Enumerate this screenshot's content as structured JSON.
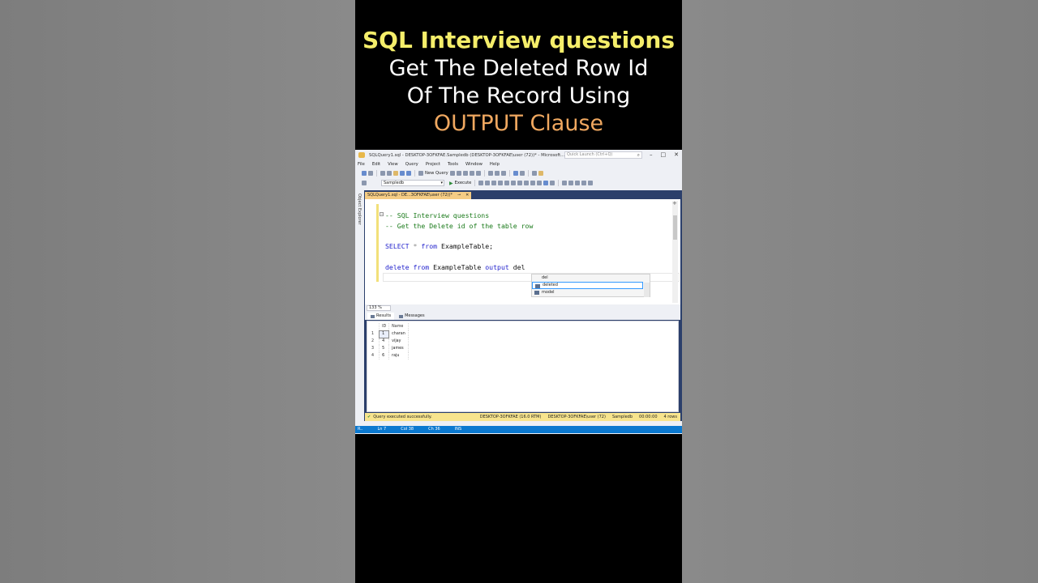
{
  "headline": {
    "line1": "SQL Interview questions",
    "line2": "Get The Deleted Row Id",
    "line3": "Of The Record Using",
    "line4": "OUTPUT Clause"
  },
  "window": {
    "title": "SQLQuery1.sql - DESKTOP-3OFKFAE.Sampledb (DESKTOP-3OFKFAE\\user (72))* - Microsoft...",
    "quick_launch_placeholder": "Quick Launch (Ctrl+Q)"
  },
  "menu": [
    "File",
    "Edit",
    "View",
    "Query",
    "Project",
    "Tools",
    "Window",
    "Help"
  ],
  "toolbar": {
    "new_query": "New Query",
    "database": "Sampledb",
    "execute": "Execute"
  },
  "object_explorer_label": "Object Explorer",
  "doc_tab": {
    "label": "SQLQuery1.sql - DE...3OFKFAE\\user (72))*",
    "pin": "⊸",
    "close": "✕"
  },
  "editor": {
    "comment1": "-- SQL Interview questions",
    "comment2": "-- Get the Delete id of the table row",
    "select_kw": "SELECT",
    "select_star": " * ",
    "select_from": "from",
    "select_rest": " ExampleTable;",
    "delete_kw": "delete",
    "delete_from": " from",
    "delete_table": " ExampleTable ",
    "delete_output": "output",
    "delete_typed": " del"
  },
  "intellisense": {
    "typed": "del",
    "items": [
      "deleted",
      "model"
    ]
  },
  "zoom": "133 %",
  "results_tabs": [
    "Results",
    "Messages"
  ],
  "results": {
    "columns": [
      "ID",
      "Name"
    ],
    "rows": [
      {
        "n": "1",
        "id": "1",
        "name": "charan"
      },
      {
        "n": "2",
        "id": "4",
        "name": "vijay"
      },
      {
        "n": "3",
        "id": "5",
        "name": "james"
      },
      {
        "n": "4",
        "id": "6",
        "name": "raju"
      }
    ]
  },
  "query_status": {
    "message": "Query executed successfully.",
    "server": "DESKTOP-3OFKFAE (16.0 RTM)",
    "user": "DESKTOP-3OFKFAE\\user (72)",
    "db": "Sampledb",
    "time": "00:00:00",
    "rows": "4 rows"
  },
  "statusbar": {
    "ready": "R..",
    "ln": "Ln 7",
    "col": "Col 38",
    "ch": "Ch 36",
    "ins": "INS"
  }
}
